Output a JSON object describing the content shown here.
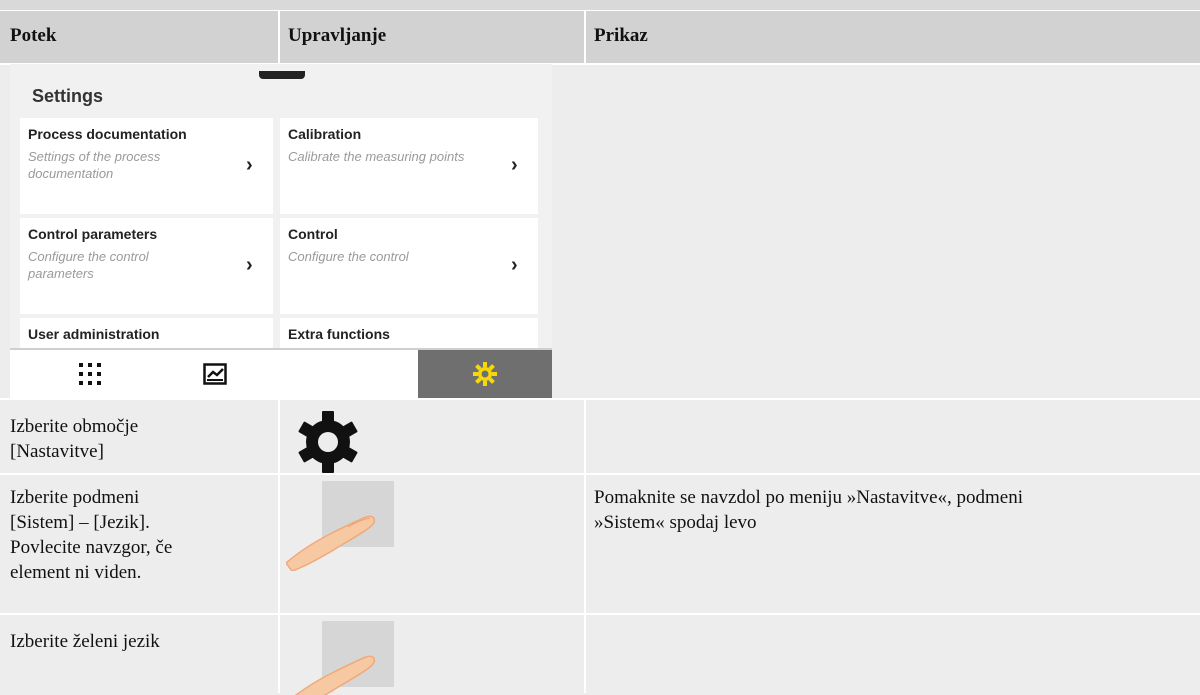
{
  "header": {
    "col1": "Potek",
    "col2": "Upravljanje",
    "col3": "Prikaz"
  },
  "settings_panel": {
    "title": "Settings",
    "tiles": [
      {
        "name": "Process documentation",
        "desc_line1": "Settings of the process",
        "desc_line2": "documentation"
      },
      {
        "name": "Calibration",
        "desc_line1": "Calibrate the measuring points",
        "desc_line2": ""
      },
      {
        "name": "Control parameters",
        "desc_line1": "Configure the control",
        "desc_line2": "parameters"
      },
      {
        "name": "Control",
        "desc_line1": "Configure the control",
        "desc_line2": ""
      },
      {
        "name": "User administration"
      },
      {
        "name": "Extra functions"
      }
    ],
    "chevron": "›",
    "nav_icons": [
      "grid-icon",
      "chart-icon",
      "gear-icon"
    ],
    "active_color": "#f5d90a"
  },
  "rows": [
    {
      "step_lines": [
        "Izberite območje",
        "[Nastavitve]"
      ],
      "display": ""
    },
    {
      "step_lines": [
        "Izberite podmeni",
        "[Sistem] – [Jezik].",
        "Povlecite navzgor, če",
        "element ni viden."
      ],
      "display_lines": [
        "Pomaknite se navzdol po meniju »Nastavitve«, podmeni",
        "»Sistem« spodaj levo"
      ]
    },
    {
      "step_lines": [
        "Izberite želeni jezik"
      ],
      "display": ""
    }
  ]
}
